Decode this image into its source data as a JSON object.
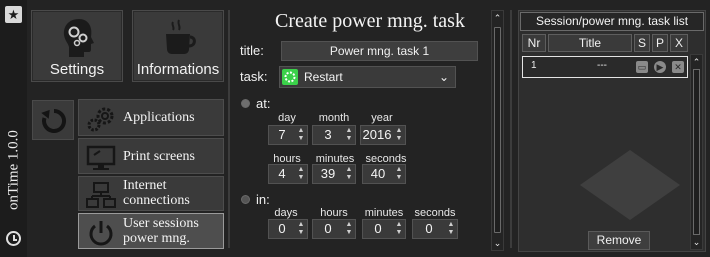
{
  "sidebar": {
    "version_label": "onTime 1.0.0"
  },
  "tiles": {
    "settings": "Settings",
    "informations": "Informations"
  },
  "nav": [
    {
      "label": "Applications",
      "icon": "gears-icon"
    },
    {
      "label": "Print screens",
      "icon": "monitor-icon"
    },
    {
      "label": "Internet connections",
      "icon": "network-icon"
    },
    {
      "label": "User sessions power mng.",
      "icon": "power-icon"
    }
  ],
  "form": {
    "heading": "Create power mng. task",
    "title_label": "title:",
    "title_value": "Power mng. task 1",
    "task_label": "task:",
    "task_value": "Restart",
    "at_label": "at:",
    "at": {
      "day_label": "day",
      "month_label": "month",
      "year_label": "year",
      "day": "7",
      "month": "3",
      "year": "2016",
      "hours_label": "hours",
      "minutes_label": "minutes",
      "seconds_label": "seconds",
      "hours": "4",
      "minutes": "39",
      "seconds": "40"
    },
    "in_label": "in:",
    "in": {
      "days_label": "days",
      "hours_label": "hours",
      "minutes_label": "minutes",
      "seconds_label": "seconds",
      "days": "0",
      "hours": "0",
      "minutes": "0",
      "seconds": "0"
    }
  },
  "task_list": {
    "heading": "Session/power mng. task list",
    "columns": [
      "Nr",
      "Title",
      "S",
      "P",
      "X"
    ],
    "rows": [
      {
        "nr": "1",
        "title": "---"
      }
    ],
    "remove_label": "Remove"
  },
  "colors": {
    "background": "#232323",
    "tile": "#3a3a3a",
    "task_icon": "#3bd14a"
  }
}
